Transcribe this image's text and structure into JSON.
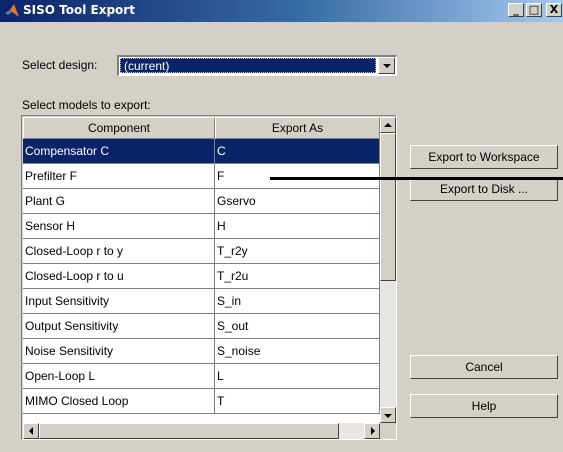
{
  "window": {
    "title": "SISO Tool Export",
    "minimize_glyph": "_",
    "maximize_glyph": "□",
    "close_glyph": "X"
  },
  "design": {
    "label": "Select design:",
    "selected": "(current)"
  },
  "models": {
    "label": "Select models to export:",
    "columns": [
      "Component",
      "Export As"
    ],
    "rows": [
      {
        "component": "Compensator C",
        "export_as": "C"
      },
      {
        "component": "Prefilter F",
        "export_as": "F"
      },
      {
        "component": "Plant G",
        "export_as": "Gservo"
      },
      {
        "component": "Sensor H",
        "export_as": "H"
      },
      {
        "component": "Closed-Loop r to y",
        "export_as": "T_r2y"
      },
      {
        "component": "Closed-Loop r to u",
        "export_as": "T_r2u"
      },
      {
        "component": "Input Sensitivity",
        "export_as": "S_in"
      },
      {
        "component": "Output Sensitivity",
        "export_as": "S_out"
      },
      {
        "component": "Noise Sensitivity",
        "export_as": "S_noise"
      },
      {
        "component": "Open-Loop L",
        "export_as": "L"
      },
      {
        "component": "MIMO Closed Loop",
        "export_as": "T"
      }
    ],
    "selected_row": 0
  },
  "buttons": {
    "export_workspace": "Export to Workspace",
    "export_disk": "Export to Disk ...",
    "cancel": "Cancel",
    "help": "Help"
  },
  "colors": {
    "selection": "#0a246a",
    "face": "#d4d0c8",
    "title_gradient_start": "#0a246a",
    "title_gradient_end": "#a6caf0"
  },
  "icons": {
    "app": "matlab-logo-icon",
    "minimize": "minimize-icon",
    "maximize": "maximize-icon",
    "close": "close-icon"
  }
}
